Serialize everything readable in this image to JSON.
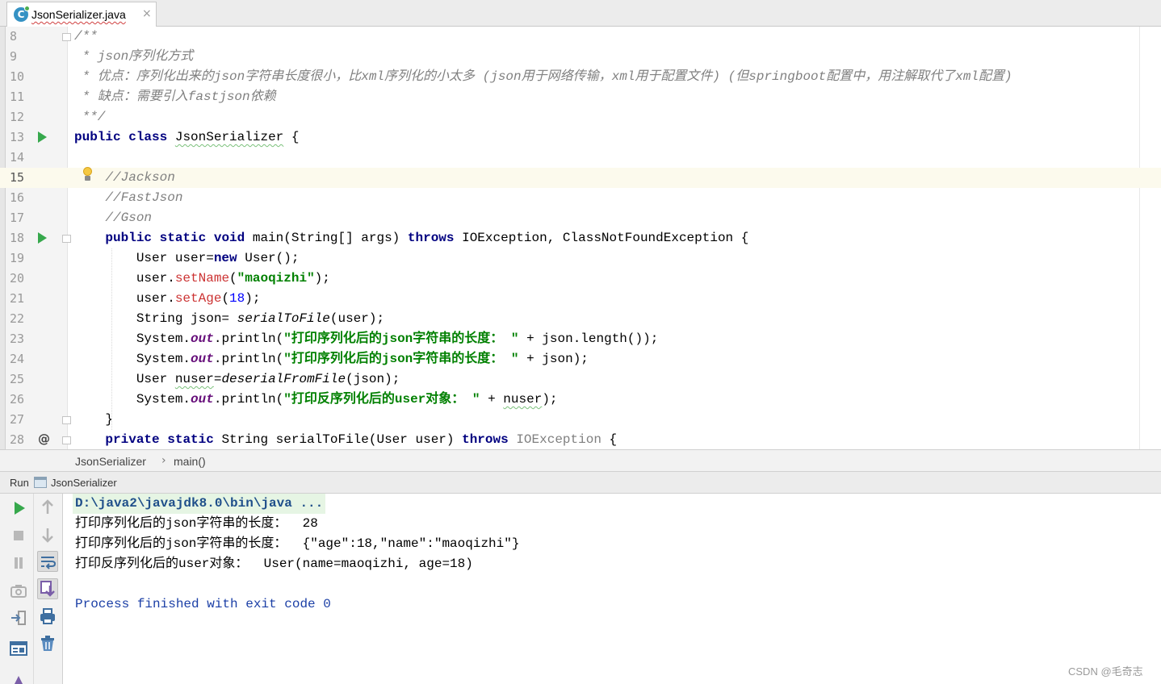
{
  "tab": {
    "title": "JsonSerializer.java",
    "icon": "java-class-icon",
    "close": "×"
  },
  "editor": {
    "lines": [
      {
        "n": "8",
        "text": "/**",
        "style": "comment"
      },
      {
        "n": "9",
        "text": " * json序列化方式",
        "style": "comment"
      },
      {
        "n": "10",
        "text": " * 优点：序列化出来的json字符串长度很小，比xml序列化的小太多 (json用于网络传输，xml用于配置文件) (但springboot配置中，用注解取代了xml配置)",
        "style": "comment"
      },
      {
        "n": "11",
        "text": " * 缺点：需要引入fastjson依赖",
        "style": "comment"
      },
      {
        "n": "12",
        "text": " **/",
        "style": "comment"
      },
      {
        "n": "13",
        "text": "public class JsonSerializer {",
        "style": "code"
      },
      {
        "n": "14",
        "text": "",
        "style": "code"
      },
      {
        "n": "15",
        "text": "    //Jackson",
        "style": "comment"
      },
      {
        "n": "16",
        "text": "    //FastJson",
        "style": "comment"
      },
      {
        "n": "17",
        "text": "    //Gson",
        "style": "comment"
      },
      {
        "n": "18",
        "text": "    public static void main(String[] args) throws IOException, ClassNotFoundException {",
        "style": "code"
      },
      {
        "n": "19",
        "text": "        User user=new User();",
        "style": "code"
      },
      {
        "n": "20",
        "text": "        user.setName(\"maoqizhi\");",
        "style": "code"
      },
      {
        "n": "21",
        "text": "        user.setAge(18);",
        "style": "code"
      },
      {
        "n": "22",
        "text": "        String json= serialToFile(user);",
        "style": "code"
      },
      {
        "n": "23",
        "text": "        System.out.println(\"打印序列化后的json字符串的长度： \" + json.length());",
        "style": "code"
      },
      {
        "n": "24",
        "text": "        System.out.println(\"打印序列化后的json字符串的长度： \" + json);",
        "style": "code"
      },
      {
        "n": "25",
        "text": "        User nuser=deserialFromFile(json);",
        "style": "code"
      },
      {
        "n": "26",
        "text": "        System.out.println(\"打印反序列化后的user对象： \" + nuser);",
        "style": "code"
      },
      {
        "n": "27",
        "text": "    }",
        "style": "code"
      },
      {
        "n": "28",
        "text": "    private static String serialToFile(User user) throws IOException {",
        "style": "code"
      }
    ],
    "current_line": "15",
    "gutter_markers": {
      "run_lines": [
        "13",
        "18"
      ],
      "override_line": "28",
      "override_symbol": "@"
    }
  },
  "breadcrumb": {
    "class": "JsonSerializer",
    "separator": "›",
    "method": "main()"
  },
  "run_window": {
    "label": "Run",
    "config": "JsonSerializer",
    "toolbar_left": [
      "rerun-icon",
      "stop-icon",
      "pause-icon",
      "screenshot-icon",
      "exit-icon",
      "layout-icon"
    ],
    "toolbar_right": [
      "up-arrow-icon",
      "down-arrow-icon",
      "soft-wrap-icon",
      "scroll-to-end-icon",
      "print-icon",
      "trash-icon"
    ]
  },
  "console": {
    "command": "D:\\java2\\javajdk8.0\\bin\\java ...",
    "output": [
      "打印序列化后的json字符串的长度：  28",
      "打印序列化后的json字符串的长度：  {\"age\":18,\"name\":\"maoqizhi\"}",
      "打印反序列化后的user对象：  User(name=maoqizhi, age=18)"
    ],
    "exit_message": "Process finished with exit code 0"
  },
  "watermark": "CSDN @毛奇志",
  "colors": {
    "keyword": "#000080",
    "comment": "#808080",
    "string": "#008000",
    "method_call": "#cc3333",
    "number": "#0000ff",
    "static_field": "#660e7a",
    "current_line_bg": "#fcfaed"
  }
}
